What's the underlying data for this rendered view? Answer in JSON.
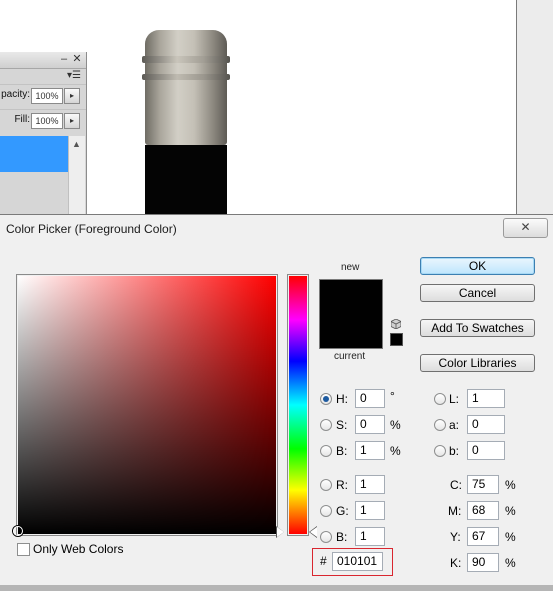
{
  "layers_panel": {
    "opacity_label": "pacity:",
    "opacity_value": "100%",
    "fill_label": "Fill:",
    "fill_value": "100%",
    "minimize_glyph": "–",
    "close_glyph": "✕",
    "menu_glyph": "▾☰",
    "arrow_glyph": "▸"
  },
  "dialog": {
    "title": "Color Picker (Foreground Color)",
    "close_glyph": "✕",
    "new_label": "new",
    "current_label": "current",
    "buttons": {
      "ok": "OK",
      "cancel": "Cancel",
      "add_to_swatches": "Add To Swatches",
      "color_libraries": "Color Libraries"
    },
    "only_web_colors": "Only Web Colors",
    "selected_mode": "H",
    "hsb": {
      "H": "0",
      "S": "0",
      "B": "1",
      "H_unit": "°",
      "S_unit": "%",
      "B_unit": "%"
    },
    "rgb": {
      "R": "1",
      "G": "1",
      "B": "1"
    },
    "lab": {
      "L": "1",
      "a": "0",
      "b": "0"
    },
    "cmyk": {
      "C": "75",
      "M": "68",
      "Y": "67",
      "K": "90",
      "unit": "%"
    },
    "hex_hash": "#",
    "hex": "010101",
    "labels": {
      "H": "H:",
      "S": "S:",
      "B": "B:",
      "R": "R:",
      "G": "G:",
      "B2": "B:",
      "L": "L:",
      "a": "a:",
      "b": "b:",
      "C": "C:",
      "M": "M:",
      "Y": "Y:",
      "K": "K:"
    }
  },
  "colors": {
    "current_color": "#010101",
    "selection_blue": "#3399ff",
    "hex_highlight": "#d9262f"
  }
}
